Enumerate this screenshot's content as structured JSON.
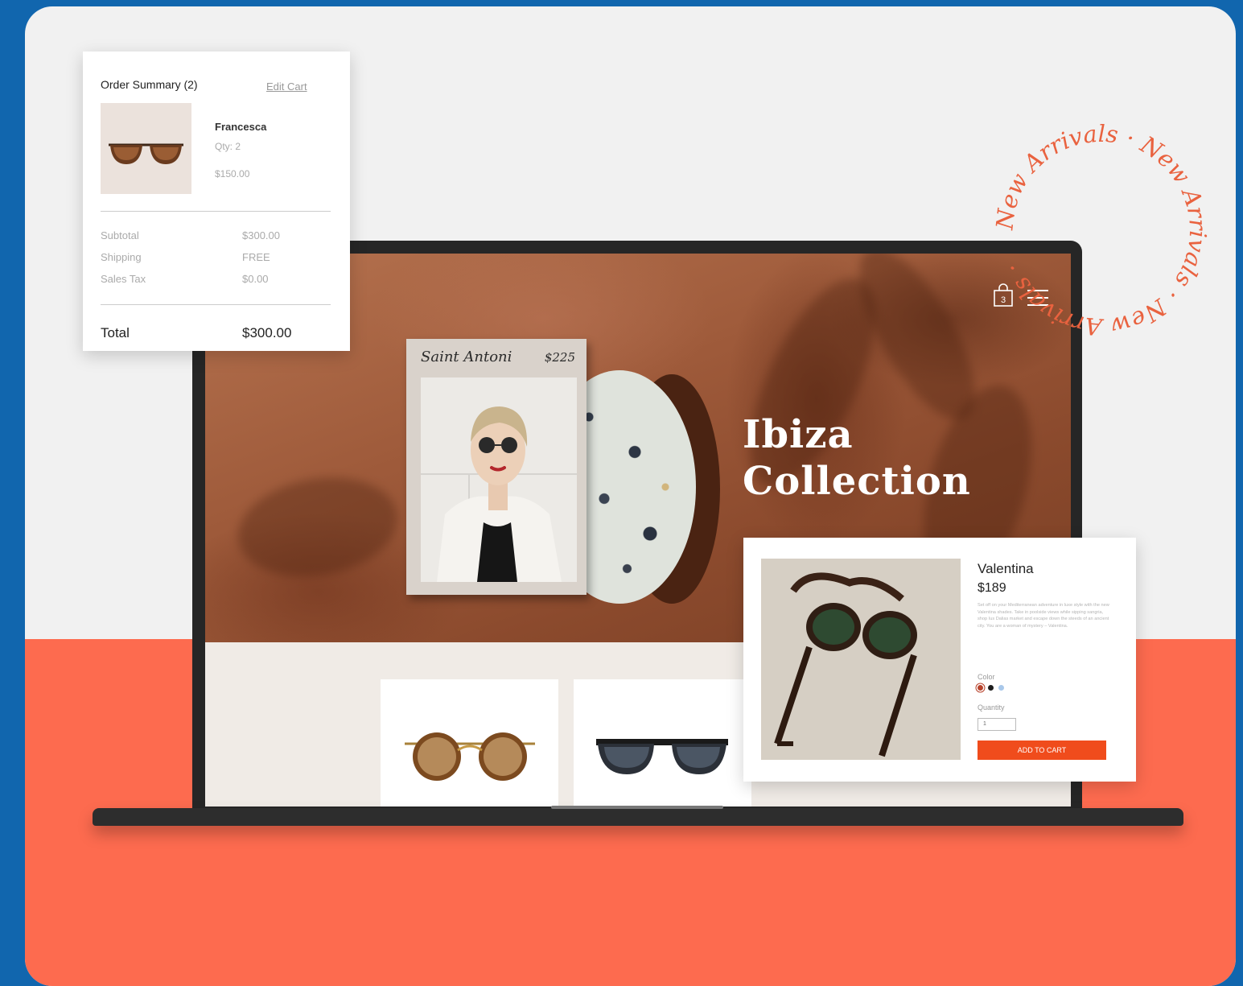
{
  "colors": {
    "background_blue": "#1166ae",
    "card_light": "#f1f1f1",
    "coral": "#fd6b4f",
    "accent_orange": "#f04c1c",
    "hero_brown": "#9e5a3a",
    "badge_text": "#e9623f"
  },
  "order_summary": {
    "title": "Order Summary (2)",
    "edit_link": "Edit Cart",
    "item": {
      "name": "Francesca",
      "qty": "Qty: 2",
      "price": "$150.00"
    },
    "rows": [
      {
        "label": "Subtotal",
        "value": "$300.00"
      },
      {
        "label": "Shipping",
        "value": "FREE"
      },
      {
        "label": "Sales Tax",
        "value": "$0.00"
      }
    ],
    "total_label": "Total",
    "total_value": "$300.00"
  },
  "site": {
    "hero_title_line1": "Ibiza",
    "hero_title_line2": "Collection",
    "cart_count": "3",
    "icons": [
      "shopping-bag-icon",
      "hamburger-menu-icon"
    ],
    "featured_card": {
      "name": "Saint Antoni",
      "price": "$225"
    }
  },
  "quick_view": {
    "name": "Valentina",
    "price": "$189",
    "description": "Set off on your Mediterranean adventure in luxe style with the new Valentina shades. Take in poolside views while sipping sangria, shop Ius Dalias market and escape down the steeds of an ancient city. You are a woman of mystery – Valentina.",
    "color_label": "Color",
    "colors": [
      "#b8432c",
      "#1d1d1d",
      "#a9c8ea"
    ],
    "quantity_label": "Quantity",
    "quantity_value": "1",
    "button_label": "ADD TO CART"
  },
  "badge": {
    "text": "New Arrivals · New Arrivals · New Arrivals · "
  }
}
